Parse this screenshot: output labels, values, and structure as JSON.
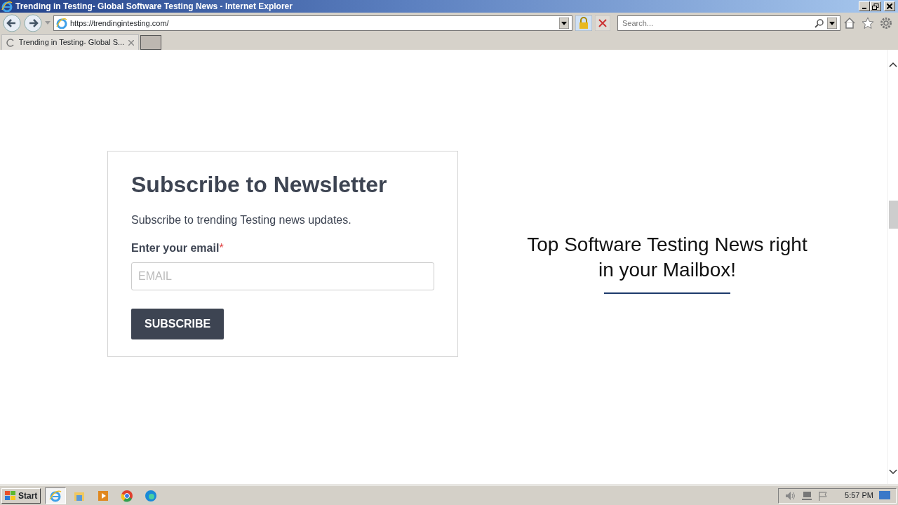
{
  "window": {
    "title": "Trending in Testing- Global Software Testing News - Internet Explorer"
  },
  "address_bar": {
    "url": "https://trendingintesting.com/"
  },
  "search": {
    "placeholder": "Search..."
  },
  "tabs": [
    {
      "label": "Trending in Testing- Global S...",
      "selected": true
    }
  ],
  "newsletter": {
    "heading": "Subscribe to Newsletter",
    "description": "Subscribe to trending Testing news updates.",
    "email_label": "Enter your email",
    "required_mark": "*",
    "email": {
      "placeholder": "EMAIL"
    },
    "button": "SUBSCRIBE"
  },
  "tagline": "Top Software Testing News right in your Mailbox!",
  "taskbar": {
    "start": "Start",
    "items": [
      {
        "kind": "ie",
        "selected": true
      },
      {
        "kind": "folder",
        "selected": false
      },
      {
        "kind": "media",
        "selected": false
      },
      {
        "kind": "chrome",
        "selected": false
      },
      {
        "kind": "edge",
        "selected": false
      }
    ],
    "clock": "5:57 PM"
  }
}
